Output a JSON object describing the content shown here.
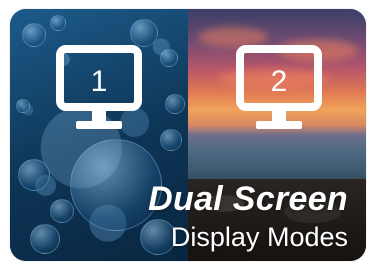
{
  "banner": {
    "title": "Dual Screen",
    "subtitle": "Display Modes"
  },
  "monitors": [
    {
      "label": "1",
      "icon": "monitor-icon"
    },
    {
      "label": "2",
      "icon": "monitor-icon"
    }
  ],
  "colors": {
    "text": "#ffffff",
    "left_panel": "#0e3556",
    "right_panel_sunset": "#e07a54"
  }
}
